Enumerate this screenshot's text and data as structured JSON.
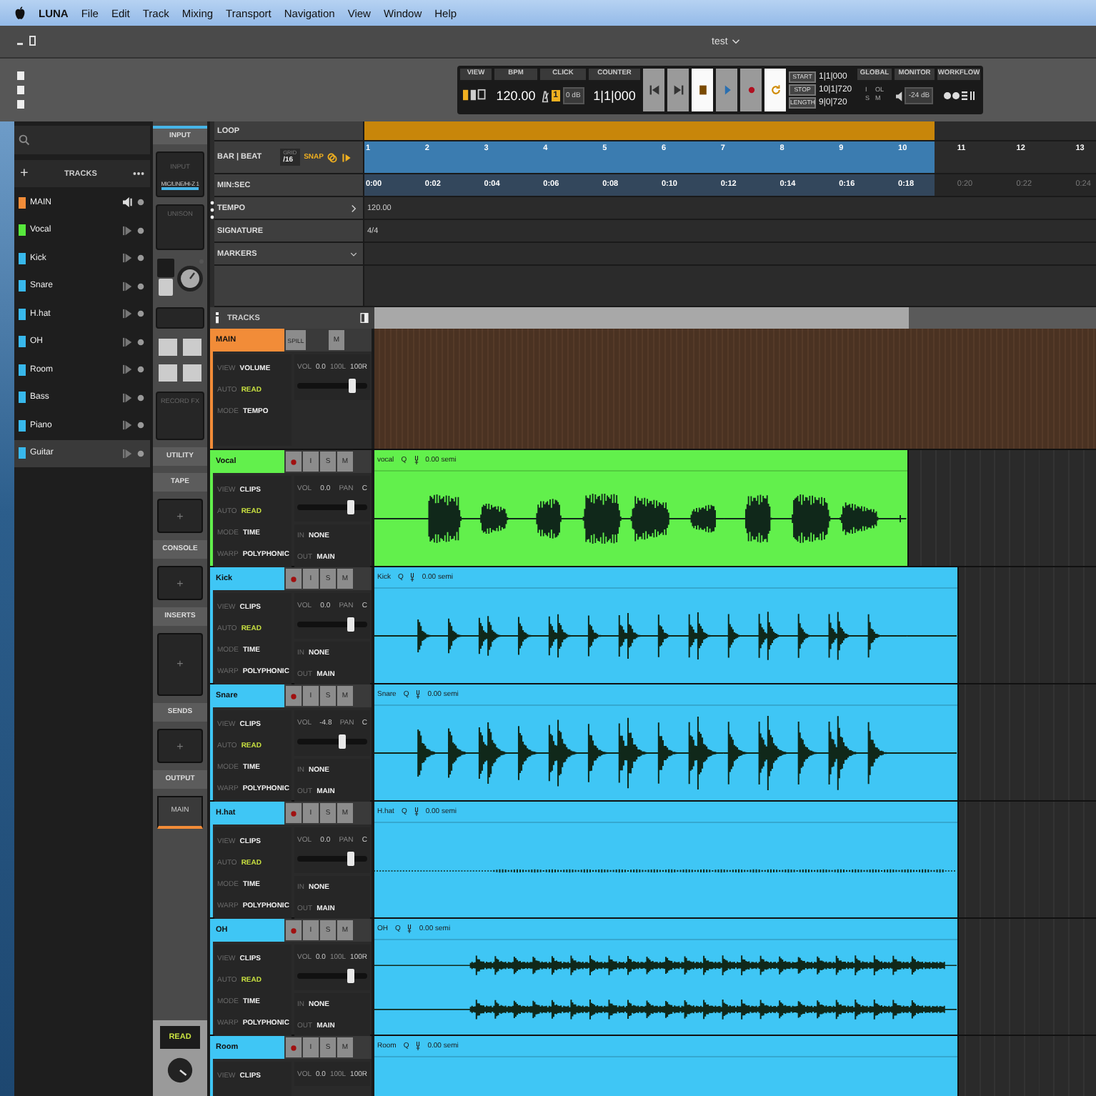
{
  "menubar": {
    "app": "LUNA",
    "items": [
      "File",
      "Edit",
      "Track",
      "Mixing",
      "Transport",
      "Navigation",
      "View",
      "Window",
      "Help"
    ]
  },
  "window": {
    "title": "test"
  },
  "transport": {
    "view_label": "VIEW",
    "bpm_label": "BPM",
    "bpm": "120.00",
    "click_label": "CLICK",
    "click_count": "1",
    "click_level": "0 dB",
    "counter_label": "COUNTER",
    "counter": "1|1|000",
    "buttons": [
      {
        "kind": "rewind",
        "active": false
      },
      {
        "kind": "forward",
        "active": false
      },
      {
        "kind": "stop",
        "active": true
      },
      {
        "kind": "play",
        "active": false
      },
      {
        "kind": "record",
        "active": false
      },
      {
        "kind": "loop",
        "active": true
      }
    ],
    "range": [
      {
        "label": "START",
        "value": "1|1|000"
      },
      {
        "label": "STOP",
        "value": "10|1|720"
      },
      {
        "label": "LENGTH",
        "value": "9|0|720"
      }
    ],
    "global_label": "GLOBAL",
    "global_flags": [
      "I",
      "OL",
      "S",
      "M"
    ],
    "monitor_label": "MONITOR",
    "monitor_level": "-24 dB",
    "workflow_label": "WORKFLOW"
  },
  "sidebar": {
    "add": "+",
    "header": "TRACKS",
    "tracks": [
      {
        "kind": "main",
        "name": "MAIN",
        "color": "#f28c38",
        "selected": false
      },
      {
        "kind": "audio",
        "name": "Vocal",
        "color": "#57e83c",
        "selected": false
      },
      {
        "kind": "audio",
        "name": "Kick",
        "color": "#38b8ec",
        "selected": false
      },
      {
        "kind": "audio",
        "name": "Snare",
        "color": "#38b8ec",
        "selected": false
      },
      {
        "kind": "audio",
        "name": "H.hat",
        "color": "#38b8ec",
        "selected": false
      },
      {
        "kind": "audio",
        "name": "OH",
        "color": "#38b8ec",
        "selected": false
      },
      {
        "kind": "audio",
        "name": "Room",
        "color": "#38b8ec",
        "selected": false
      },
      {
        "kind": "audio",
        "name": "Bass",
        "color": "#38b8ec",
        "selected": false
      },
      {
        "kind": "audio",
        "name": "Piano",
        "color": "#38b8ec",
        "selected": false
      },
      {
        "kind": "audio",
        "name": "Guitar",
        "color": "#38b8ec",
        "selected": true
      }
    ]
  },
  "inspector": {
    "tab": {
      "label": "INPUT",
      "selected": true
    },
    "input_label": "INPUT",
    "input_source": "MIC/LINE/HI-Z 1",
    "unison": "UNISON",
    "record_fx": "RECORD FX",
    "sections": [
      {
        "kind": "tab",
        "label": "UTILITY"
      },
      {
        "kind": "tab",
        "label": "TAPE"
      },
      {
        "kind": "slot",
        "label": "+"
      },
      {
        "kind": "tab",
        "label": "CONSOLE"
      },
      {
        "kind": "slot",
        "label": "+"
      },
      {
        "kind": "tab",
        "label": "INSERTS"
      },
      {
        "kind": "big_slot",
        "label": "+"
      },
      {
        "kind": "tab",
        "label": "SENDS"
      },
      {
        "kind": "slot",
        "label": "+"
      },
      {
        "kind": "tab",
        "label": "OUTPUT"
      },
      {
        "kind": "output",
        "label": "MAIN"
      }
    ],
    "automation": "READ"
  },
  "rulers": {
    "loop": "LOOP",
    "bar_beat": "BAR | BEAT",
    "grid_label": "GRID",
    "grid_value": "/16",
    "snap": "SNAP",
    "bars": [
      "1",
      "2",
      "3",
      "4",
      "5",
      "6",
      "7",
      "8",
      "9",
      "10",
      "11",
      "12",
      "13"
    ],
    "min_sec": "MIN:SEC",
    "times": [
      "0:00",
      "0:02",
      "0:04",
      "0:06",
      "0:08",
      "0:10",
      "0:12",
      "0:14",
      "0:16",
      "0:18",
      "0:20",
      "0:22",
      "0:24"
    ],
    "tempo_label": "TEMPO",
    "tempo": "120.00",
    "signature_label": "SIGNATURE",
    "signature": "4/4",
    "markers_label": "MARKERS"
  },
  "tracks_bar": "TRACKS",
  "tracks": [
    {
      "kind": "main",
      "name": "MAIN",
      "color": "#f28c38",
      "spill": "SPILL",
      "buttons": [
        "M"
      ],
      "settings": [
        {
          "label": "VIEW",
          "value": "VOLUME"
        },
        {
          "label": "AUTO",
          "value": "READ"
        },
        {
          "label": "MODE",
          "value": "TEMPO"
        }
      ],
      "mix": [
        "VOL",
        "0.0",
        "100L",
        "100R"
      ],
      "level": 0.8
    },
    {
      "kind": "audio",
      "name": "Vocal",
      "color": "#62f04c",
      "buttons": [
        "I",
        "S",
        "M"
      ],
      "settings": [
        {
          "label": "VIEW",
          "value": "CLIPS"
        },
        {
          "label": "AUTO",
          "value": "READ"
        },
        {
          "label": "MODE",
          "value": "TIME"
        },
        {
          "label": "WARP",
          "value": "POLYPHONIC"
        }
      ],
      "mix": [
        "VOL",
        "0.0",
        "PAN",
        "C"
      ],
      "level": 0.77,
      "io": [
        {
          "label": "IN",
          "value": "NONE"
        },
        {
          "label": "OUT",
          "value": "MAIN"
        }
      ],
      "clip": {
        "name": "vocal",
        "quantize": "Q",
        "pitch": "0.00 semi",
        "kind": "vocal"
      }
    },
    {
      "kind": "audio",
      "name": "Kick",
      "color": "#3fc6f5",
      "buttons": [
        "I",
        "S",
        "M"
      ],
      "settings": [
        {
          "label": "VIEW",
          "value": "CLIPS"
        },
        {
          "label": "AUTO",
          "value": "READ"
        },
        {
          "label": "MODE",
          "value": "TIME"
        },
        {
          "label": "WARP",
          "value": "POLYPHONIC"
        }
      ],
      "mix": [
        "VOL",
        "0.0",
        "PAN",
        "C"
      ],
      "level": 0.77,
      "io": [
        {
          "label": "IN",
          "value": "NONE"
        },
        {
          "label": "OUT",
          "value": "MAIN"
        }
      ],
      "clip": {
        "name": "Kick",
        "quantize": "Q",
        "pitch": "0.00 semi",
        "kind": "kick"
      }
    },
    {
      "kind": "audio",
      "name": "Snare",
      "color": "#3fc6f5",
      "buttons": [
        "I",
        "S",
        "M"
      ],
      "settings": [
        {
          "label": "VIEW",
          "value": "CLIPS"
        },
        {
          "label": "AUTO",
          "value": "READ"
        },
        {
          "label": "MODE",
          "value": "TIME"
        },
        {
          "label": "WARP",
          "value": "POLYPHONIC"
        }
      ],
      "mix": [
        "VOL",
        "-4.8",
        "PAN",
        "C"
      ],
      "level": 0.65,
      "io": [
        {
          "label": "IN",
          "value": "NONE"
        },
        {
          "label": "OUT",
          "value": "MAIN"
        }
      ],
      "clip": {
        "name": "Snare",
        "quantize": "Q",
        "pitch": "0.00 semi",
        "kind": "snare"
      }
    },
    {
      "kind": "audio",
      "name": "H.hat",
      "color": "#3fc6f5",
      "buttons": [
        "I",
        "S",
        "M"
      ],
      "settings": [
        {
          "label": "VIEW",
          "value": "CLIPS"
        },
        {
          "label": "AUTO",
          "value": "READ"
        },
        {
          "label": "MODE",
          "value": "TIME"
        },
        {
          "label": "WARP",
          "value": "POLYPHONIC"
        }
      ],
      "mix": [
        "VOL",
        "0.0",
        "PAN",
        "C"
      ],
      "level": 0.77,
      "io": [
        {
          "label": "IN",
          "value": "NONE"
        },
        {
          "label": "OUT",
          "value": "MAIN"
        }
      ],
      "clip": {
        "name": "H.hat",
        "quantize": "Q",
        "pitch": "0.00 semi",
        "kind": "flat"
      }
    },
    {
      "kind": "audio",
      "name": "OH",
      "color": "#3fc6f5",
      "buttons": [
        "I",
        "S",
        "M"
      ],
      "settings": [
        {
          "label": "VIEW",
          "value": "CLIPS"
        },
        {
          "label": "AUTO",
          "value": "READ"
        },
        {
          "label": "MODE",
          "value": "TIME"
        },
        {
          "label": "WARP",
          "value": "POLYPHONIC"
        }
      ],
      "mix": [
        "VOL",
        "0.0",
        "100L",
        "100R"
      ],
      "level": 0.77,
      "io": [
        {
          "label": "IN",
          "value": "NONE"
        },
        {
          "label": "OUT",
          "value": "MAIN"
        }
      ],
      "clip": {
        "name": "OH",
        "quantize": "Q",
        "pitch": "0.00 semi",
        "kind": "stereo"
      }
    },
    {
      "kind": "audio",
      "name": "Room",
      "color": "#3fc6f5",
      "buttons": [
        "I",
        "S",
        "M"
      ],
      "settings": [
        {
          "label": "VIEW",
          "value": "CLIPS"
        }
      ],
      "mix": [
        "VOL",
        "0.0",
        "100L",
        "100R"
      ],
      "clip": {
        "name": "Room",
        "quantize": "Q",
        "pitch": "0.00 semi",
        "kind": "blank"
      }
    }
  ]
}
